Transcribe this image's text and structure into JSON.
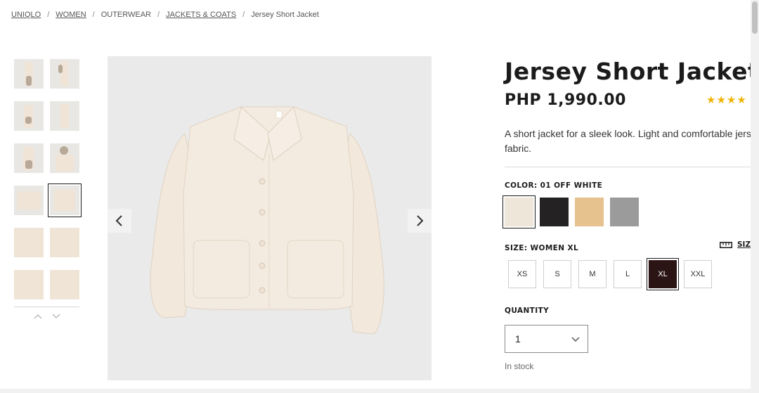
{
  "breadcrumb": {
    "items": [
      {
        "label": "UNIQLO",
        "link": true
      },
      {
        "label": "WOMEN",
        "link": true
      },
      {
        "label": "OUTERWEAR",
        "link": false
      },
      {
        "label": "JACKETS & COATS",
        "link": true
      },
      {
        "label": "Jersey Short Jacket",
        "link": false
      }
    ],
    "separator": "/"
  },
  "gallery": {
    "thumbnail_count": 12,
    "selected_thumbnail": 8,
    "prev_icon": "chevron-left-icon",
    "next_icon": "chevron-right-icon",
    "thumb_up_icon": "chevron-up-icon",
    "thumb_down_icon": "chevron-down-icon"
  },
  "product": {
    "title": "Jersey Short Jacket",
    "price": "PHP 1,990.00",
    "stars": "★★★★",
    "description_line1": "A short jacket for a sleek look. Light and comfortable jersey",
    "description_line2": "fabric.",
    "color_label": "COLOR: 01 OFF WHITE",
    "colors": [
      {
        "name": "off-white",
        "hex": "#efe6da",
        "selected": true
      },
      {
        "name": "black",
        "hex": "#242222",
        "selected": false
      },
      {
        "name": "beige",
        "hex": "#e6c28e",
        "selected": false
      },
      {
        "name": "gray",
        "hex": "#9b9b9b",
        "selected": false
      }
    ],
    "size_label": "SIZE: WOMEN XL",
    "size_guide": "SIZE",
    "size_guide_icon": "ruler-icon",
    "sizes": [
      {
        "label": "XS",
        "selected": false
      },
      {
        "label": "S",
        "selected": false
      },
      {
        "label": "M",
        "selected": false
      },
      {
        "label": "L",
        "selected": false
      },
      {
        "label": "XL",
        "selected": true
      },
      {
        "label": "XXL",
        "selected": false
      }
    ],
    "quantity_label": "QUANTITY",
    "quantity_value": "1",
    "stock": "In stock"
  },
  "colors": {
    "star": "#f0b400",
    "selected_size_bg": "#2a1414",
    "jacket": "#f2e8dc"
  }
}
